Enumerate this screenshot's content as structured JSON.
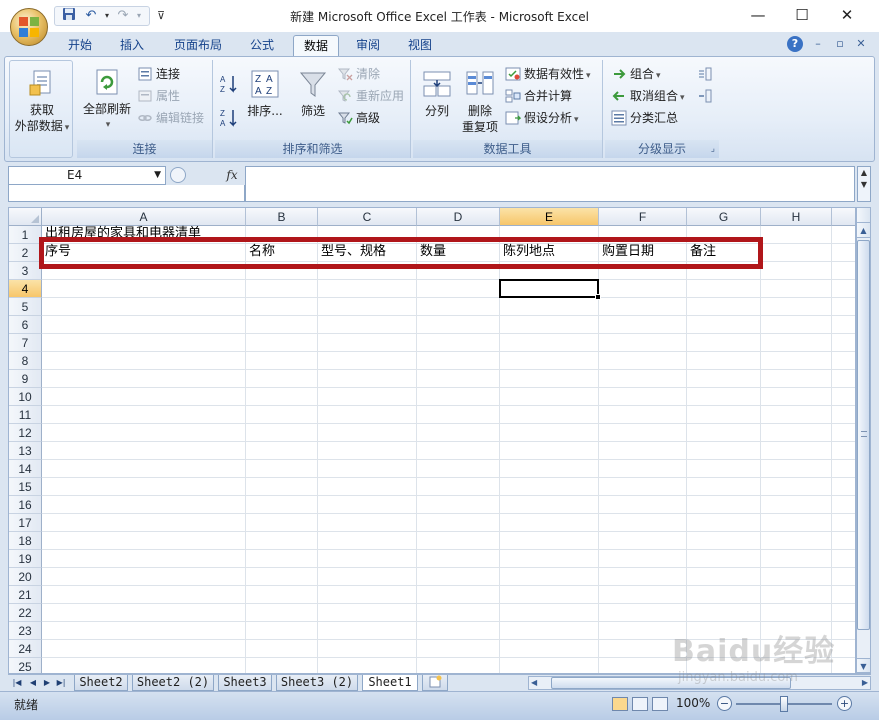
{
  "window": {
    "title": "新建 Microsoft Office Excel 工作表 - Microsoft Excel",
    "minimize": "—",
    "maximize": "☐",
    "close": "✕",
    "qat_customize": "⊽"
  },
  "tabs": [
    {
      "label": "开始",
      "active": false
    },
    {
      "label": "插入",
      "active": false
    },
    {
      "label": "页面布局",
      "active": false
    },
    {
      "label": "公式",
      "active": false
    },
    {
      "label": "数据",
      "active": true
    },
    {
      "label": "审阅",
      "active": false
    },
    {
      "label": "视图",
      "active": false
    }
  ],
  "ribbon": {
    "get_external": {
      "line1": "获取",
      "line2": "外部数据"
    },
    "connections": {
      "label": "连接",
      "refresh_all": "全部刷新",
      "connections": "连接",
      "properties": "属性",
      "edit_links": "编辑链接"
    },
    "sort_filter": {
      "label": "排序和筛选",
      "sort": "排序...",
      "filter": "筛选",
      "clear": "清除",
      "reapply": "重新应用",
      "advanced": "高级"
    },
    "data_tools": {
      "label": "数据工具",
      "text_to_columns": "分列",
      "remove_dup_1": "删除",
      "remove_dup_2": "重复项",
      "validation": "数据有效性",
      "consolidate": "合并计算",
      "whatif": "假设分析"
    },
    "outline": {
      "label": "分级显示",
      "group": "组合",
      "ungroup": "取消组合",
      "subtotal": "分类汇总"
    }
  },
  "formula_bar": {
    "name_box": "E4",
    "fx": "fx",
    "value": ""
  },
  "sheet": {
    "columns": [
      "A",
      "B",
      "C",
      "D",
      "E",
      "F",
      "G",
      "H"
    ],
    "rows": [
      "1",
      "2",
      "3",
      "4",
      "5",
      "6",
      "7",
      "8",
      "9",
      "10",
      "11",
      "12",
      "13",
      "14",
      "15",
      "16",
      "17",
      "18",
      "19",
      "20",
      "21",
      "22",
      "23",
      "24",
      "25"
    ],
    "selected_col": "E",
    "selected_row": "4",
    "cells": {
      "A1": "出租房屋的家具和电器清单",
      "A2": "序号",
      "B2": "名称",
      "C2": "型号、规格",
      "D2": "数量",
      "E2": "陈列地点",
      "F2": "购置日期",
      "G2": "备注"
    }
  },
  "sheet_tabs": [
    {
      "label": "Sheet2",
      "active": false
    },
    {
      "label": "Sheet2 (2)",
      "active": false
    },
    {
      "label": "Sheet3",
      "active": false
    },
    {
      "label": "Sheet3 (2)",
      "active": false
    },
    {
      "label": "Sheet1",
      "active": true
    }
  ],
  "status": {
    "ready": "就绪",
    "zoom": "100%"
  },
  "watermark": {
    "brand": "Baidu经验",
    "url": "jingyan.baidu.com"
  },
  "colors": {
    "highlight_box": "#b0161a",
    "selection_header": "#f7c66a"
  }
}
